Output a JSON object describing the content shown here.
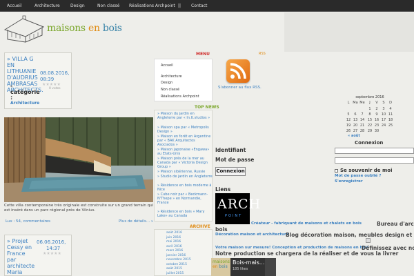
{
  "nav": {
    "items": [
      "Accueil",
      "Architecture",
      "Design",
      "Non classé",
      "Réalisations Archpoint",
      "||",
      "Contact"
    ]
  },
  "logo": {
    "part1": "maisons",
    "part2": "en",
    "part3": "bois"
  },
  "post1": {
    "title": "» VILLA G EN LITHUANIE D'AUDRIUS AMBRASAS ARCHITECTS.",
    "date_line1": "08.08.2016,",
    "date_line2": "08:39",
    "votes": "0 votes",
    "stars": "★★★★★",
    "category_label_1": "-",
    "category_label_2": "catégorie",
    "category_label_3": ":",
    "category_link": "Architecture",
    "caption": "Cette villa contemporaine très originale est construite sur un grand terrain qui est inséré dans un parc régional près de Vilnius.",
    "lux": "Lux : 54",
    "comments": "commentaires",
    "read_more": "Plus de détails... »"
  },
  "post2": {
    "title": "» Projet Cessy en France par architecte Maria Musaiova, Archpoint",
    "date": "06.06.2016,",
    "time": "14:37",
    "stars": "★★★★★"
  },
  "menu": {
    "label": "MENU",
    "items": [
      "Accueil",
      "Architecture",
      "Design",
      "Non classé",
      "Réalisations Archpoint"
    ]
  },
  "rss": {
    "label": "RSS",
    "subscribe": "S'abonner au flux RSS."
  },
  "topnew": {
    "label": "TOP NEWS",
    "items": [
      "» Maison du jardin en Angleterre par « In.It.studios »",
      "» Maison spa par « Metropolis Design »",
      "» Maison en forêt en Argentine par « BAK Arquitectos Asociados »",
      "» Maison japonaise «Engawa» au Etats-Unis",
      "» Maison près de la mer au Canada par « Victoria Design Group »",
      "» Maison sibérienne, Russie",
      "» Studio de jardin en Angleterre",
      "» Résidence en bois moderne à Nice",
      "» Cube noir par « Beckmann-N'Thepe » en Normandie, France",
      "» Résidence en bois « Mary Lake» au Canada"
    ]
  },
  "archive": {
    "label": "ARCHIVE",
    "items": [
      "août 2016",
      "juin 2016",
      "mai 2016",
      "avril 2016",
      "mars 2016",
      "janvier 2016",
      "novembre 2015",
      "octobre 2015",
      "août 2015",
      "juillet 2015"
    ]
  },
  "calendar": {
    "title": "septembre 2016",
    "headers": [
      "L",
      "Ma",
      "Me",
      "J",
      "V",
      "S",
      "D"
    ],
    "rows": [
      [
        "",
        "",
        "",
        "1",
        "2",
        "3",
        "4"
      ],
      [
        "5",
        "6",
        "7",
        "8",
        "9",
        "10",
        "11"
      ],
      [
        "12",
        "13",
        "14",
        "15",
        "16",
        "17",
        "18"
      ],
      [
        "19",
        "20",
        "21",
        "22",
        "23",
        "24",
        "25"
      ],
      [
        "26",
        "27",
        "28",
        "29",
        "30",
        "",
        ""
      ]
    ],
    "prev": "« août"
  },
  "login": {
    "identifiant": "Identifiant",
    "password": "Mot de passe",
    "button": "Connexion",
    "title": "Connexion",
    "remember": "Se souvenir de moi",
    "forgot": "Mot de passe oublié ?",
    "register": "S'enregistrer"
  },
  "links": {
    "title": "Liens",
    "arch_logo_big": "ARCH",
    "arch_logo_small": "POINT",
    "line1_link": "Créateur - fabriquant de maisons et chalets en bois",
    "line1_text": "Bureau d'arch",
    "line2_prefix": "bois",
    "line3_link": "Décoration maison et architecture",
    "line3_text": "Blog décoration maison, meubles design et arch",
    "line4_link": "Votre maison sur mesure! Conception et production de maisons en bois",
    "line4_text": "Définissez avec nous",
    "line5_text": "Notre production se chargera de la réaliser et de vous la livrer"
  },
  "facebook": {
    "thumb_1": "maisons",
    "thumb_2": "en",
    "thumb_3": "bois",
    "title": "Bois-mais...",
    "likes": "185 likes"
  },
  "colors": {
    "accent_blue": "#3a7fc0",
    "green": "#7aa62a",
    "orange": "#e08a10",
    "red": "#d03030",
    "nav_bg": "#2a2a2a"
  }
}
